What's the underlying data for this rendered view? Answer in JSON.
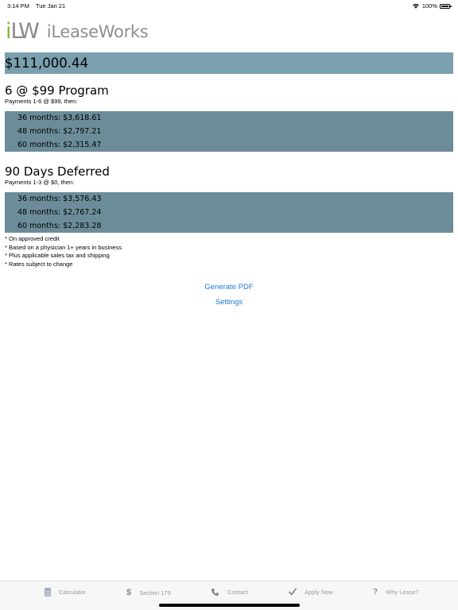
{
  "status_bar": {
    "time": "3:14 PM",
    "date": "Tue Jan 21",
    "battery": "100%"
  },
  "logo": {
    "mark_i": "i",
    "mark_lw": "LW",
    "text": "iLeaseWorks"
  },
  "total": "$111,000.44",
  "programs": [
    {
      "title": "6 @ $99 Program",
      "subtitle": "Payments 1-6 @ $99, then:",
      "rates": [
        "36 months: $3,618.61",
        "48 months: $2,797.21",
        "60 months: $2,315.47"
      ]
    },
    {
      "title": "90 Days Deferred",
      "subtitle": "Payments 1-3 @ $0, then:",
      "rates": [
        "36 months: $3,576.43",
        "48 months: $2,767.24",
        "60 months: $2,283.28"
      ]
    }
  ],
  "notes": [
    "* On approved credit",
    "* Based on a physician 1+ years in business",
    "* Plus applicable sales tax and shipping",
    "* Rates subject to change"
  ],
  "actions": {
    "generate_pdf": "Generate PDF",
    "settings": "Settings"
  },
  "tabs": [
    {
      "label": "Calculator",
      "icon": "calculator-icon"
    },
    {
      "label": "Section 179",
      "icon": "dollar-icon"
    },
    {
      "label": "Contact",
      "icon": "phone-icon"
    },
    {
      "label": "Apply Now",
      "icon": "checkmark-icon"
    },
    {
      "label": "Why Lease?",
      "icon": "question-icon"
    }
  ],
  "colors": {
    "total_bar": "#7a9fae",
    "rate_block": "#6c8c99",
    "link": "#1a7ad6",
    "logo_green": "#8cb33a",
    "logo_gray": "#8e8e8e"
  }
}
